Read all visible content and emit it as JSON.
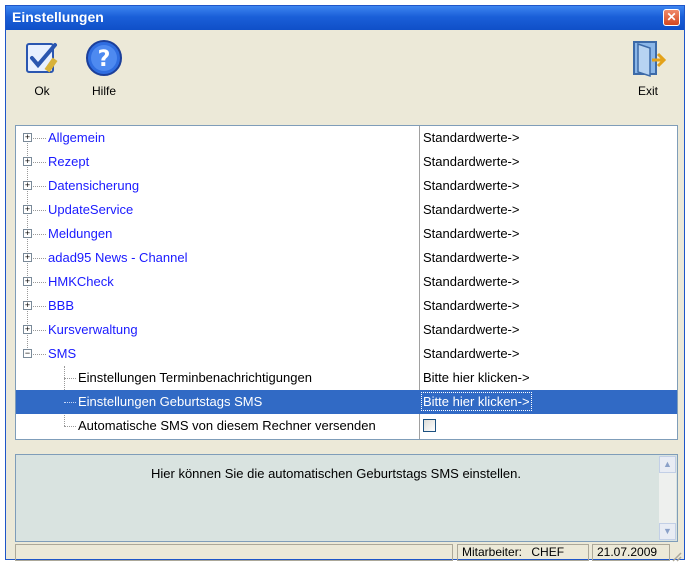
{
  "window": {
    "title": "Einstellungen"
  },
  "toolbar": {
    "ok_label": "Ok",
    "help_label": "Hilfe",
    "exit_label": "Exit"
  },
  "tree": {
    "items": [
      {
        "label": "Allgemein",
        "value": "Standardwerte->",
        "expanded": false
      },
      {
        "label": "Rezept",
        "value": "Standardwerte->",
        "expanded": false
      },
      {
        "label": "Datensicherung",
        "value": "Standardwerte->",
        "expanded": false
      },
      {
        "label": "UpdateService",
        "value": "Standardwerte->",
        "expanded": false
      },
      {
        "label": "Meldungen",
        "value": "Standardwerte->",
        "expanded": false
      },
      {
        "label": "adad95 News - Channel",
        "value": "Standardwerte->",
        "expanded": false
      },
      {
        "label": "HMKCheck",
        "value": "Standardwerte->",
        "expanded": false
      },
      {
        "label": "BBB",
        "value": "Standardwerte->",
        "expanded": false
      },
      {
        "label": "Kursverwaltung",
        "value": "Standardwerte->",
        "expanded": false
      },
      {
        "label": "SMS",
        "value": "Standardwerte->",
        "expanded": true
      }
    ],
    "sms_children": [
      {
        "label": "Einstellungen Terminbenachrichtigungen",
        "value": "Bitte hier klicken->"
      },
      {
        "label": "Einstellungen Geburtstags SMS",
        "value": "Bitte hier klicken->",
        "selected": true
      },
      {
        "label": "Automatische SMS von diesem Rechner versenden",
        "checked": false
      }
    ]
  },
  "info": {
    "text": "Hier können Sie die automatischen Geburtstags SMS einstellen."
  },
  "status": {
    "employee_label": "Mitarbeiter:",
    "employee_value": "CHEF",
    "date": "21.07.2009"
  },
  "colors": {
    "title_bar": "#0f4fc8",
    "selection": "#316ac5",
    "link_text": "#1a1aff"
  }
}
